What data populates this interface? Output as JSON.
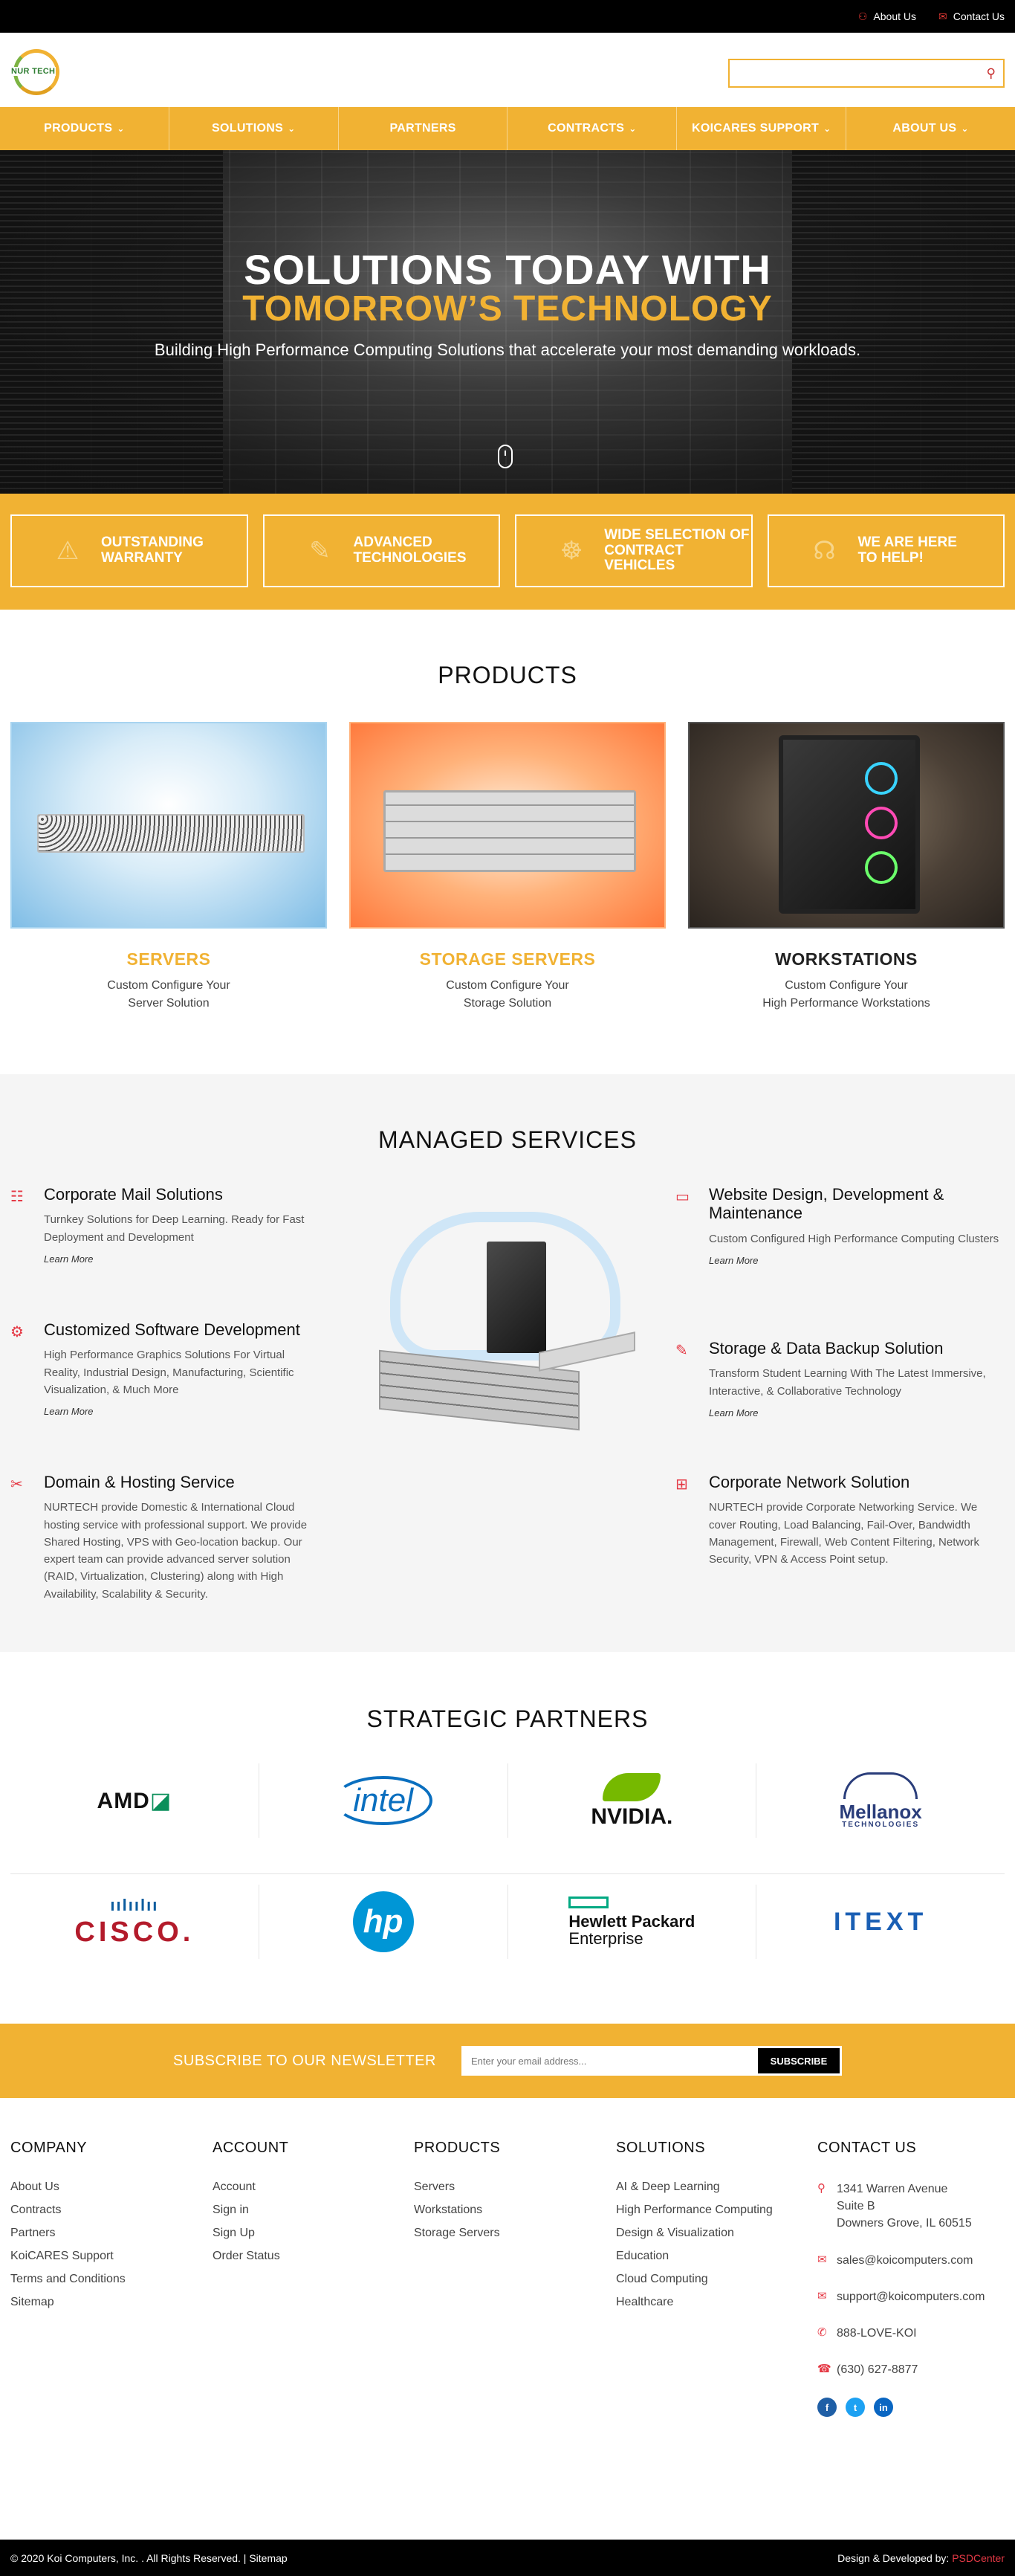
{
  "topbar": {
    "about_label": "About Us",
    "contact_label": "Contact Us"
  },
  "header": {
    "logo_text": "NUR TECH",
    "search_placeholder": ""
  },
  "nav": [
    {
      "label": "PRODUCTS",
      "has_caret": true
    },
    {
      "label": "SOLUTIONS",
      "has_caret": true
    },
    {
      "label": "PARTNERS",
      "has_caret": false
    },
    {
      "label": "CONTRACTS",
      "has_caret": true
    },
    {
      "label": "KOICARES SUPPORT",
      "has_caret": true
    },
    {
      "label": "ABOUT US",
      "has_caret": true
    }
  ],
  "hero": {
    "title_line1": "SOLUTIONS TODAY WITH",
    "title_line2": "TOMORROW’S TECHNOLOGY",
    "subtitle": "Building High Performance Computing Solutions that accelerate your most demanding workloads."
  },
  "features": [
    {
      "line1": "OUTSTANDING",
      "line2": "WARRANTY",
      "icon": "warning-icon"
    },
    {
      "line1": "ADVANCED",
      "line2": "TECHNOLOGIES",
      "icon": "wrench-icon"
    },
    {
      "line1": "WIDE SELECTION OF",
      "line2": "CONTRACT VEHICLES",
      "icon": "handshake-icon"
    },
    {
      "line1": "WE ARE HERE",
      "line2": "TO HELP!",
      "icon": "support-icon"
    }
  ],
  "products": {
    "title": "PRODUCTS",
    "items": [
      {
        "name": "SERVERS",
        "desc1": "Custom Configure Your",
        "desc2": "Server Solution"
      },
      {
        "name": "STORAGE SERVERS",
        "desc1": "Custom Configure Your",
        "desc2": "Storage Solution"
      },
      {
        "name": "WORKSTATIONS",
        "desc1": "Custom Configure Your",
        "desc2": "High Performance Workstations"
      }
    ]
  },
  "managed": {
    "title": "MANAGED SERVICES",
    "left": [
      {
        "heading": "Corporate Mail Solutions",
        "desc": "Turnkey Solutions for Deep Learning. Ready for Fast Deployment and Development",
        "link": "Learn More"
      },
      {
        "heading": "Customized Software Development",
        "desc": "High Performance Graphics Solutions For Virtual Reality, Industrial Design, Manufacturing, Scientific Visualization, & Much More",
        "link": "Learn More"
      },
      {
        "heading": "Domain & Hosting Service",
        "desc": "NURTECH provide Domestic & International Cloud hosting service with professional support. We provide Shared Hosting, VPS with Geo-location backup. Our expert team can provide advanced server solution (RAID, Virtualization, Clustering) along with High Availability, Scalability & Security.",
        "link": ""
      }
    ],
    "right": [
      {
        "heading": "Website Design, Development & Maintenance",
        "desc": "Custom Configured High Performance Computing Clusters",
        "link": "Learn More"
      },
      {
        "heading": "Storage & Data Backup Solution",
        "desc": "Transform Student Learning With The Latest Immersive, Interactive, & Collaborative Technology",
        "link": "Learn More"
      },
      {
        "heading": "Corporate Network Solution",
        "desc": "NURTECH provide Corporate Networking Service. We cover Routing, Load Balancing, Fail-Over, Bandwidth Management, Firewall, Web Content Filtering, Network Security, VPN & Access Point setup.",
        "link": ""
      }
    ]
  },
  "partners": {
    "title": "STRATEGIC PARTNERS",
    "logos": {
      "amd": "AMD",
      "intel": "intel",
      "nvidia": "NVIDIA.",
      "mellanox": "Mellanox",
      "mellanox_sub": "TECHNOLOGIES",
      "cisco": "CISCO.",
      "hp": "hp",
      "hpe1": "Hewlett Packard",
      "hpe2": "Enterprise",
      "itext": "ITEXT"
    }
  },
  "newsletter": {
    "title": "SUBSCRIBE TO OUR NEWSLETTER",
    "placeholder": "Enter your email address...",
    "button": "SUBSCRIBE"
  },
  "footer": {
    "company": {
      "title": "COMPANY",
      "links": [
        "About Us",
        "Contracts",
        "Partners",
        "KoiCARES Support",
        "Terms and Conditions",
        "Sitemap"
      ]
    },
    "account": {
      "title": "ACCOUNT",
      "links": [
        "Account",
        "Sign in",
        "Sign Up",
        "Order Status"
      ]
    },
    "products": {
      "title": "PRODUCTS",
      "links": [
        "Servers",
        "Workstations",
        "Storage Servers"
      ]
    },
    "solutions": {
      "title": "SOLUTIONS",
      "links": [
        "AI & Deep Learning",
        "High Performance Computing",
        "Design & Visualization",
        "Education",
        "Cloud Computing",
        "Healthcare"
      ]
    },
    "contact": {
      "title": "CONTACT US",
      "addr1": "1341 Warren Avenue",
      "addr2": "Suite B",
      "addr3": "Downers Grove, IL 60515",
      "email1": "sales@koicomputers.com",
      "email2": "support@koicomputers.com",
      "phone1": "888-LOVE-KOI",
      "phone2": "(630) 627-8877"
    }
  },
  "bottom": {
    "copyright": "© 2020 Koi Computers, Inc. . All Rights Reserved. | Sitemap",
    "dev_prefix": "Design & Developed by:",
    "dev_name": "PSDCenter"
  },
  "colors": {
    "accent": "#f1b233",
    "icon_red": "#e53945",
    "black": "#000000"
  }
}
